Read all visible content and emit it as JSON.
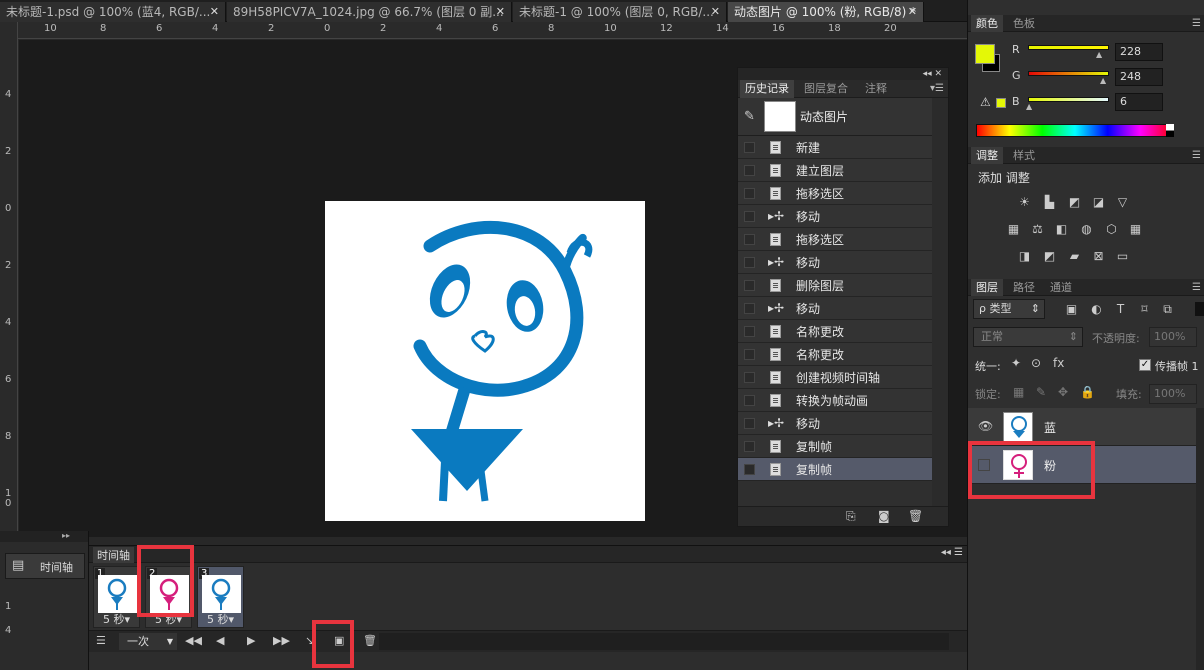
{
  "tabs": [
    {
      "label": "未标题-1.psd @ 100% (蓝4, RGB/...",
      "active": false
    },
    {
      "label": "89H58PICV7A_1024.jpg @ 66.7% (图层 0 副...",
      "active": false
    },
    {
      "label": "未标题-1 @ 100% (图层 0, RGB/...",
      "active": false
    },
    {
      "label": "动态图片 @ 100% (粉, RGB/8) *",
      "active": true
    }
  ],
  "ruler": {
    "h_ticks": [
      "10",
      "8",
      "6",
      "4",
      "2",
      "0",
      "2",
      "4",
      "6",
      "8",
      "10",
      "12",
      "14",
      "16",
      "18",
      "20"
    ],
    "v_ticks": [
      "4",
      "2",
      "0",
      "2",
      "4",
      "6",
      "8",
      "1\n0"
    ],
    "tl_ticks": [
      "1",
      "4"
    ]
  },
  "history": {
    "tabs": [
      "历史记录",
      "图层复合",
      "注释"
    ],
    "snapshot_label": "动态图片",
    "items": [
      {
        "label": "新建",
        "icon": "doc"
      },
      {
        "label": "建立图层",
        "icon": "doc"
      },
      {
        "label": "拖移选区",
        "icon": "doc"
      },
      {
        "label": "移动",
        "icon": "move"
      },
      {
        "label": "拖移选区",
        "icon": "doc"
      },
      {
        "label": "移动",
        "icon": "move"
      },
      {
        "label": "删除图层",
        "icon": "doc"
      },
      {
        "label": "移动",
        "icon": "move"
      },
      {
        "label": "名称更改",
        "icon": "doc"
      },
      {
        "label": "名称更改",
        "icon": "doc"
      },
      {
        "label": "创建视频时间轴",
        "icon": "doc"
      },
      {
        "label": "转换为帧动画",
        "icon": "doc"
      },
      {
        "label": "移动",
        "icon": "move"
      },
      {
        "label": "复制帧",
        "icon": "doc"
      },
      {
        "label": "复制帧",
        "icon": "doc",
        "selected": true
      }
    ]
  },
  "color": {
    "tabs": [
      "颜色",
      "色板"
    ],
    "r_label": "R",
    "g_label": "G",
    "b_label": "B",
    "r": "228",
    "g": "248",
    "b": "6",
    "foreground": "#e4f806"
  },
  "adjust": {
    "tabs": [
      "调整",
      "样式"
    ],
    "title": "添加 调整"
  },
  "layers": {
    "tabs": [
      "图层",
      "路径",
      "通道"
    ],
    "filter": "ρ 类型",
    "blend": "正常",
    "opacity_label": "不透明度:",
    "opacity": "100%",
    "unify_label": "统一:",
    "propagate_label": "传播帧 1",
    "lock_label": "锁定:",
    "fill_label": "填充:",
    "fill": "100%",
    "items": [
      {
        "name": "蓝",
        "visible": true,
        "color": "#1a7cc0"
      },
      {
        "name": "粉",
        "visible": false,
        "color": "#d51f7c",
        "selected": true
      }
    ]
  },
  "timeline": {
    "title": "时间轴",
    "side_label": "时间轴",
    "loop": "一次",
    "frames": [
      {
        "num": "1",
        "dur": "5 秒",
        "color": "#1a7cc0"
      },
      {
        "num": "2",
        "dur": "5 秒",
        "color": "#d51f7c"
      },
      {
        "num": "3",
        "dur": "5 秒",
        "color": "#1a7cc0",
        "selected": true
      }
    ]
  },
  "figure_color": "#0a7ac0"
}
